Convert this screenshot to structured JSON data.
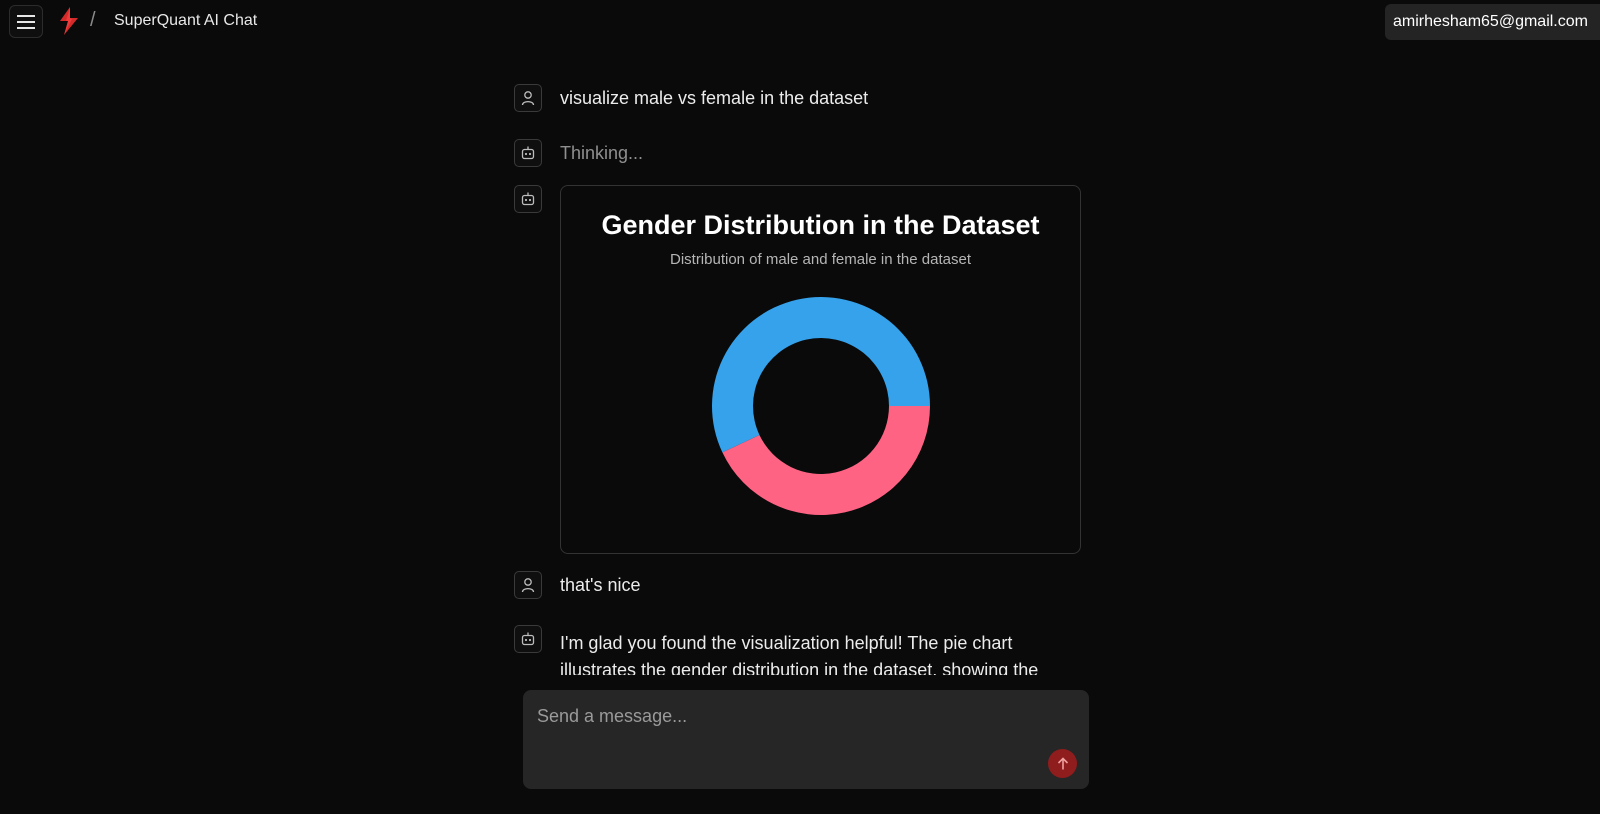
{
  "header": {
    "separator": "/",
    "app_title": "SuperQuant AI Chat",
    "user_email": "amirhesham65@gmail.com",
    "icons": {
      "menu": "hamburger-menu-icon",
      "logo": "lightning-bolt-logo"
    },
    "logo_color": "#d42a2a"
  },
  "messages": [
    {
      "role": "user",
      "text": "visualize male vs female in the dataset"
    },
    {
      "role": "assistant",
      "text": "Thinking..."
    },
    {
      "role": "assistant",
      "type": "chart"
    },
    {
      "role": "user",
      "text": "that's nice"
    },
    {
      "role": "assistant",
      "text": "I'm glad you found the visualization helpful! The pie chart illustrates the gender distribution in the dataset, showing the"
    }
  ],
  "chart": {
    "title": "Gender Distribution in the Dataset",
    "subtitle": "Distribution of male and female in the dataset"
  },
  "chart_data": {
    "type": "pie",
    "style": "donut",
    "title": "Gender Distribution in the Dataset",
    "subtitle": "Distribution of male and female in the dataset",
    "start_angle_deg": 90,
    "slices": [
      {
        "label": "",
        "value": 0.43,
        "color": "#ff6384"
      },
      {
        "label": "",
        "value": 0.57,
        "color": "#36a2eb"
      }
    ]
  },
  "composer": {
    "placeholder": "Send a message...",
    "send_icon": "arrow-up-icon",
    "send_color": "#8f1d1d"
  },
  "colors": {
    "background": "#0a0a0a",
    "surface": "#262626",
    "border": "#333333"
  }
}
